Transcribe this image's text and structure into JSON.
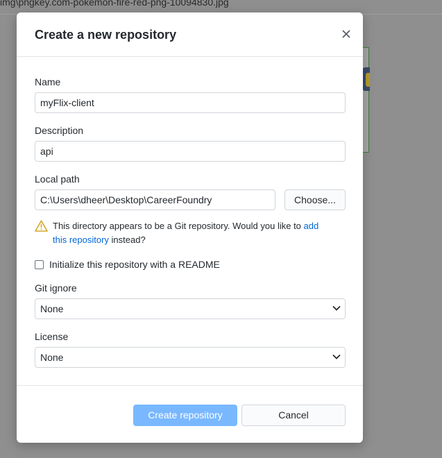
{
  "background": {
    "path_text": "img\\pngkey.com-pokemon-fire-red-png-10094830.jpg"
  },
  "dialog": {
    "title": "Create a new repository",
    "close_icon": "close-icon",
    "name": {
      "label": "Name",
      "value": "myFlix-client"
    },
    "description": {
      "label": "Description",
      "value": "api"
    },
    "local_path": {
      "label": "Local path",
      "value": "C:\\Users\\dheer\\Desktop\\CareerFoundry",
      "choose_label": "Choose..."
    },
    "warning": {
      "icon": "warning-icon",
      "text_before": "This directory appears to be a Git repository. Would you like to ",
      "link_text": "add this repository",
      "text_after": " instead?",
      "color": "#d4a72c"
    },
    "readme": {
      "label": "Initialize this repository with a README",
      "checked": false
    },
    "gitignore": {
      "label": "Git ignore",
      "selected": "None"
    },
    "license": {
      "label": "License",
      "selected": "None"
    },
    "footer": {
      "create_label": "Create repository",
      "cancel_label": "Cancel"
    },
    "colors": {
      "primary_button": "#79b8ff",
      "link": "#0366d6"
    }
  }
}
